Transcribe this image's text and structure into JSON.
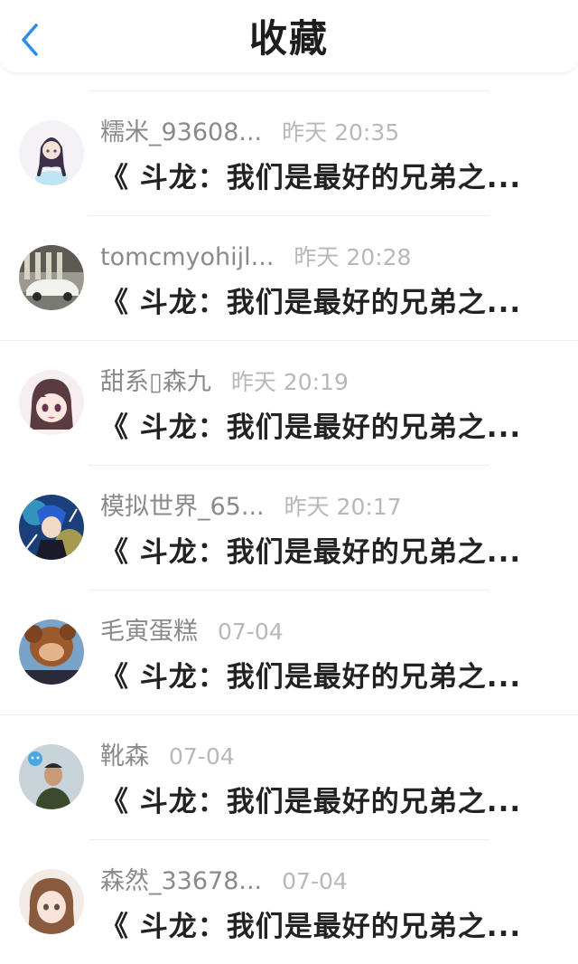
{
  "header": {
    "title": "收藏",
    "back_icon": "chevron-left-icon",
    "accent_color": "#2d8cf0"
  },
  "items": [
    {
      "name": "糯米_93608...",
      "time": "昨天 20:35",
      "snippet": "《 斗龙：我们是最好的兄弟之..."
    },
    {
      "name": "tomcmyohijl...",
      "time": "昨天 20:28",
      "snippet": "《 斗龙：我们是最好的兄弟之..."
    },
    {
      "name": "甜系▯森九",
      "time": "昨天 20:19",
      "snippet": "《 斗龙：我们是最好的兄弟之..."
    },
    {
      "name": "模拟世界_65...",
      "time": "昨天 20:17",
      "snippet": "《 斗龙：我们是最好的兄弟之..."
    },
    {
      "name": "毛寅蛋糕",
      "time": "07-04",
      "snippet": "《 斗龙：我们是最好的兄弟之..."
    },
    {
      "name": "靴森",
      "time": "07-04",
      "snippet": "《 斗龙：我们是最好的兄弟之..."
    },
    {
      "name": "森然_33678...",
      "time": "07-04",
      "snippet": "《 斗龙：我们是最好的兄弟之..."
    }
  ]
}
